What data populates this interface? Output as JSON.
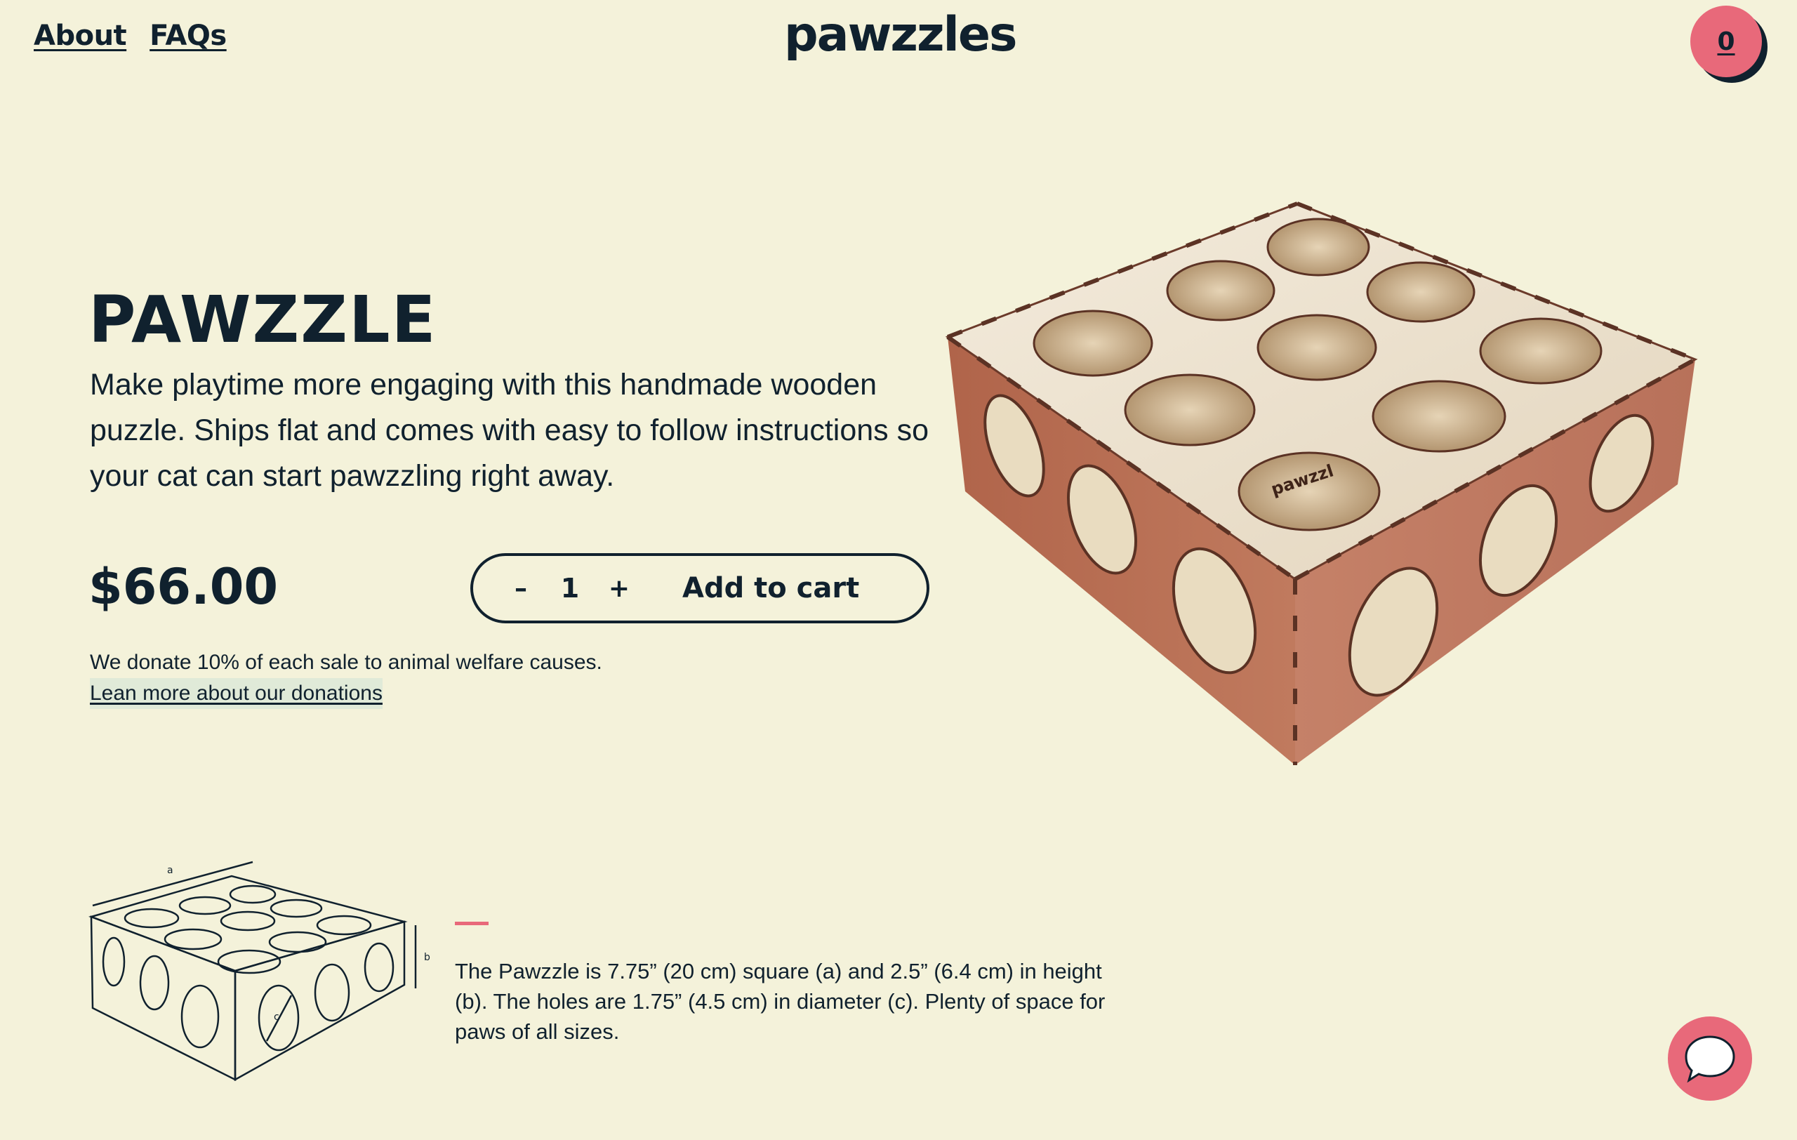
{
  "nav": {
    "about_label": "About",
    "faqs_label": "FAQs",
    "logo_text": "pawzzles",
    "cart_count": "0"
  },
  "product": {
    "title": "PAWZZLE",
    "description": "Make playtime more engaging with this handmade wooden puzzle. Ships flat and comes with easy to follow instructions so your cat can start pawzzling right away.",
    "price": "$66.00",
    "quantity": "1",
    "minus_label": "–",
    "plus_label": "+",
    "add_to_cart_label": "Add to cart",
    "photo_stamp": "pawzzl"
  },
  "donation": {
    "text": "We donate 10% of each sale to animal welfare causes.",
    "link_label": "Lean more about our donations"
  },
  "diagram": {
    "label_a": "a",
    "label_b": "b",
    "label_c": "c"
  },
  "dimensions_text": "The Pawzzle is 7.75” (20 cm) square (a) and 2.5” (6.4 cm) in height (b). The holes are 1.75” (4.5 cm) in diameter (c). Plenty of space for paws of all sizes.",
  "colors": {
    "background": "#f4f2da",
    "text": "#10212e",
    "accent": "#e8697a"
  },
  "icons": {
    "chat": "chat-bubble-icon"
  }
}
